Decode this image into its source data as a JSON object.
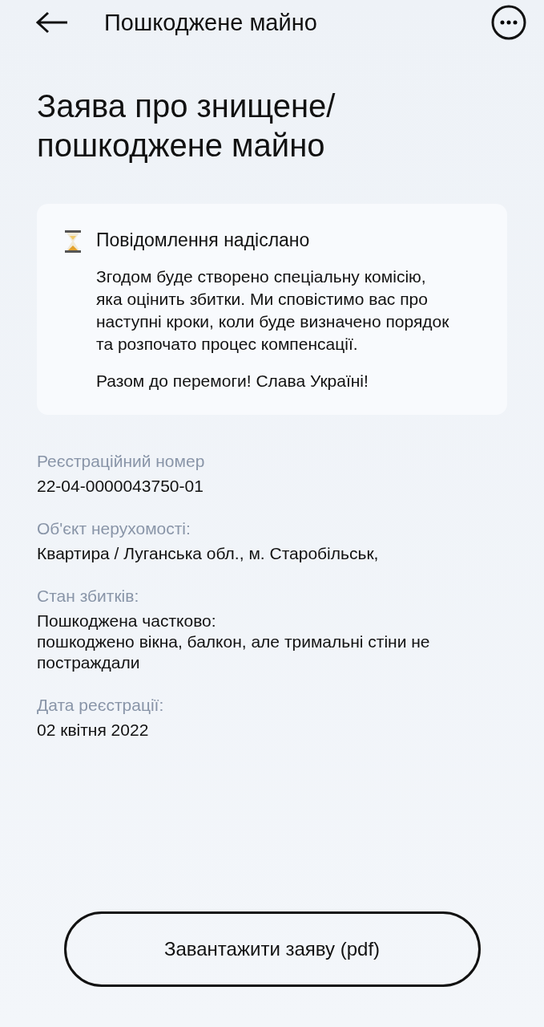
{
  "header": {
    "title": "Пошкоджене майно"
  },
  "heading": "Заява про знищене/ пошкоджене майно",
  "notice": {
    "title": "Повідомлення надіслано",
    "paragraphs": [
      "Згодом буде створено спеціальну комісію, яка оцінить збитки. Ми сповістимо вас про наступні кроки, коли буде визначено порядок та розпочато процес компенсації.",
      "Разом до перемоги! Слава Україні!"
    ]
  },
  "fields": [
    {
      "label": "Реєстраційний номер",
      "value": "22-04-0000043750-01"
    },
    {
      "label": "Об'єкт нерухомості:",
      "value": "Квартира / Луганська обл., м. Старобільськ,"
    },
    {
      "label": "Стан збитків:",
      "value": "Пошкоджена частково:\nпошкоджено вікна, балкон, але тримальні стіни не постраждали"
    },
    {
      "label": "Дата реєстрації:",
      "value": "02 квітня 2022"
    }
  ],
  "download_button": "Завантажити заяву (pdf)"
}
